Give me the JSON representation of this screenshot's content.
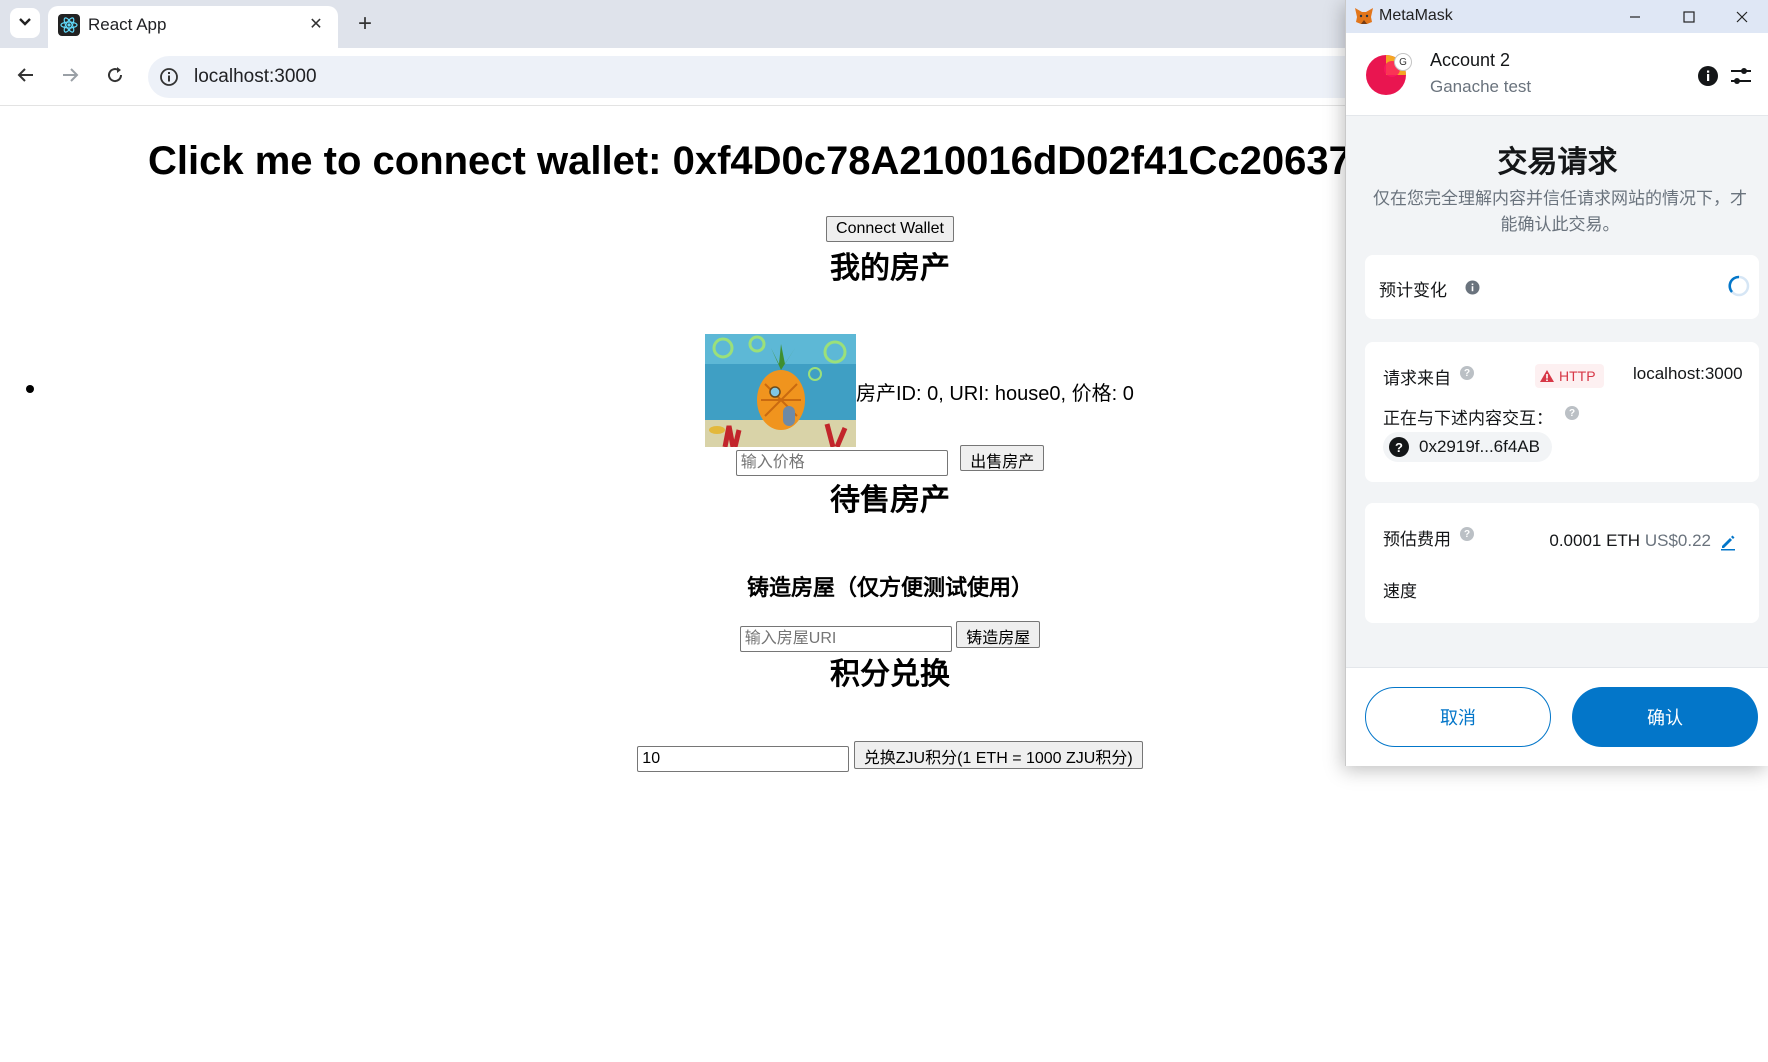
{
  "browser": {
    "tab_title": "React App",
    "url": "localhost:3000",
    "new_tab_label": "+"
  },
  "page": {
    "heading": "Click me to connect wallet: 0xf4D0c78A210016dD02f41Cc20637",
    "connect_button": "Connect Wallet",
    "my_property_title": "我的房产",
    "house": {
      "info": "房产ID: 0, URI: house0, 价格: 0"
    },
    "price_placeholder": "输入价格",
    "sell_button": "出售房产",
    "for_sale_title": "待售房产",
    "mint_title": "铸造房屋（仅方便测试使用）",
    "uri_placeholder": "输入房屋URI",
    "mint_button": "铸造房屋",
    "exchange_title": "积分兑换",
    "exchange_value": "10",
    "exchange_button": "兑换ZJU积分(1 ETH = 1000 ZJU积分)"
  },
  "metamask": {
    "window_title": "MetaMask",
    "account_name": "Account 2",
    "network_name": "Ganache test",
    "network_badge": "G",
    "heading": "交易请求",
    "description": "仅在您完全理解内容并信任请求网站的情况下，才能确认此交易。",
    "estimated_changes_label": "预计变化",
    "request_from_label": "请求来自",
    "http_badge": "HTTP",
    "request_origin": "localhost:3000",
    "interacting_label": "正在与下述内容交互：",
    "contract_address": "0x2919f...6f4AB",
    "fee_label": "预估费用",
    "fee_eth": "0.0001 ETH",
    "fee_usd": "US$0.22",
    "speed_label": "速度",
    "cancel_button": "取消",
    "confirm_button": "确认",
    "colors": {
      "primary": "#0376c9",
      "warning": "#d73847",
      "muted": "#6a737d"
    }
  }
}
